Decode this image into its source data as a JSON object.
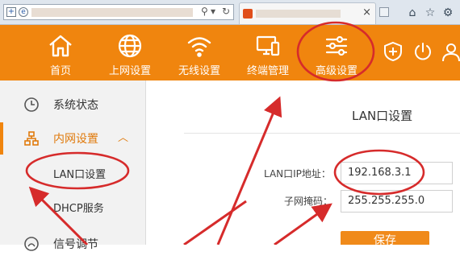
{
  "nav": {
    "items": [
      {
        "label": "首页",
        "icon": "home-icon"
      },
      {
        "label": "上网设置",
        "icon": "globe-icon"
      },
      {
        "label": "无线设置",
        "icon": "wifi-icon"
      },
      {
        "label": "终端管理",
        "icon": "devices-icon"
      },
      {
        "label": "高级设置",
        "icon": "sliders-icon"
      }
    ],
    "extra_icons": [
      "shield-plus-icon",
      "power-icon",
      "user-icon"
    ]
  },
  "sidebar": {
    "items": [
      {
        "label": "系统状态",
        "icon": "clock-icon"
      },
      {
        "label": "内网设置",
        "icon": "network-icon",
        "expanded": true
      },
      {
        "label": "LAN口设置",
        "selected": true
      },
      {
        "label": "DHCP服务"
      },
      {
        "label": "信号调节",
        "icon": "signal-icon"
      }
    ]
  },
  "main": {
    "section_title": "LAN口设置",
    "lan_ip_label": "LAN口IP地址：",
    "lan_ip_value": "192.168.3.1",
    "subnet_label": "子网掩码：",
    "subnet_value": "255.255.255.0",
    "save_label": "保存"
  },
  "colors": {
    "accent": "#f0850e",
    "annotation": "#d62b2b"
  }
}
